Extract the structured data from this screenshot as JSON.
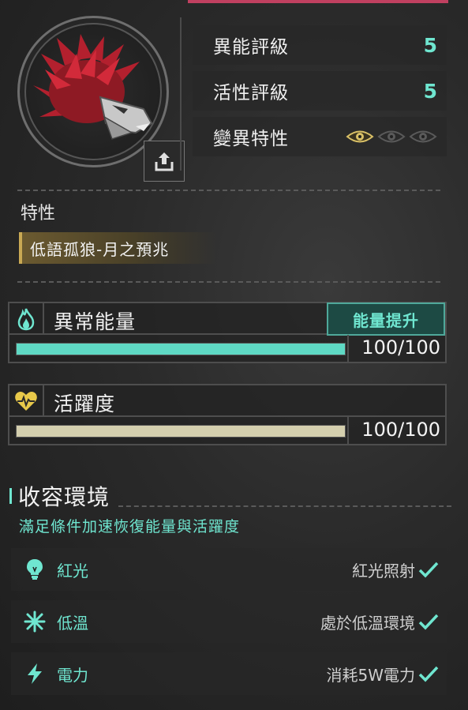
{
  "ratings": [
    {
      "label": "異能評級",
      "value": "5"
    },
    {
      "label": "活性評級",
      "value": "5"
    },
    {
      "label": "變異特性",
      "eyes_active": 1,
      "eyes_total": 3
    }
  ],
  "trait": {
    "title": "特性",
    "tag": "低語孤狼-月之預兆"
  },
  "energy": {
    "title": "異常能量",
    "button": "能量提升",
    "value_text": "100/100",
    "fraction": 1.0,
    "color": "#5fd9c4"
  },
  "vitality": {
    "title": "活躍度",
    "value_text": "100/100",
    "fraction": 1.0,
    "color": "#d4cfae"
  },
  "environment": {
    "title": "收容環境",
    "subtitle": "滿足條件加速恢復能量與活躍度",
    "items": [
      {
        "icon": "lightbulb-icon",
        "name": "紅光",
        "status": "紅光照射"
      },
      {
        "icon": "snowflake-icon",
        "name": "低溫",
        "status": "處於低溫環境"
      },
      {
        "icon": "lightning-icon",
        "name": "電力",
        "status": "消耗5W電力"
      }
    ]
  },
  "colors": {
    "accent": "#6fe6d0",
    "gold": "#c9a954",
    "top_bar": "#c04060"
  }
}
